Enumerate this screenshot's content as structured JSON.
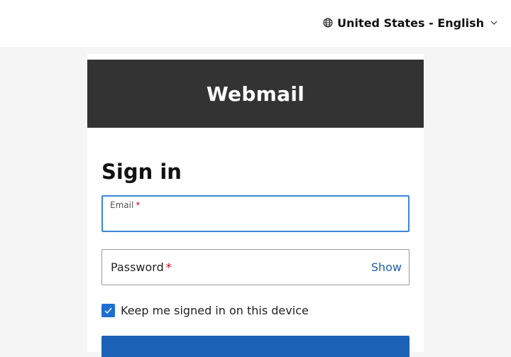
{
  "header": {
    "language_label": "United States - English",
    "globe_icon": "globe-icon",
    "chevron_icon": "chevron-down-icon"
  },
  "card": {
    "banner_title": "Webmail",
    "heading": "Sign in"
  },
  "form": {
    "email": {
      "label": "Email",
      "required_mark": "*",
      "value": "",
      "placeholder": ""
    },
    "password": {
      "label": "Password",
      "required_mark": "*",
      "value": "",
      "show_label": "Show"
    },
    "keep_signed_in": {
      "label": "Keep me signed in on this device",
      "checked": true
    },
    "submit_label": ""
  },
  "colors": {
    "accent": "#1c63b7",
    "focus_border": "#3b88d6",
    "banner_bg": "#333333",
    "required": "#d0021b",
    "link": "#1f5fa8"
  }
}
